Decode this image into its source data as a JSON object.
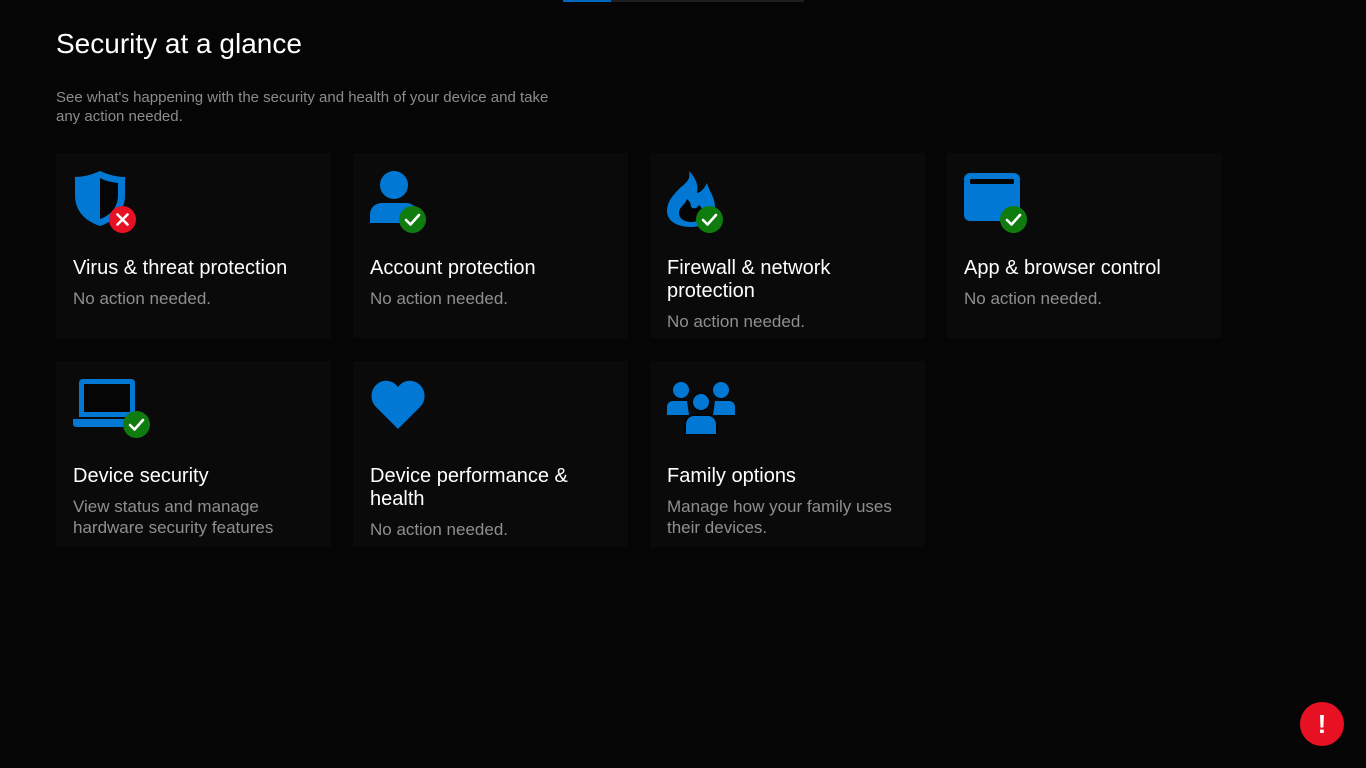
{
  "page": {
    "title": "Security at a glance",
    "subtitle": "See what's happening with the security and health of your device and take any action needed."
  },
  "colors": {
    "background": "#050505",
    "tile_background": "#0a0a0a",
    "accent_blue": "#0078d4",
    "status_ok": "#107c10",
    "status_error": "#e81123",
    "secondary_text": "#8f8f8f"
  },
  "tiles": [
    {
      "icon": "shield-icon",
      "badge": "error-x-icon",
      "title": "Virus & threat protection",
      "status": "No action needed."
    },
    {
      "icon": "person-icon",
      "badge": "checkmark-icon",
      "title": "Account protection",
      "status": "No action needed."
    },
    {
      "icon": "flame-icon",
      "badge": "checkmark-icon",
      "title": "Firewall & network protection",
      "status": "No action needed."
    },
    {
      "icon": "browser-window-icon",
      "badge": "checkmark-icon",
      "title": "App & browser control",
      "status": "No action needed."
    },
    {
      "icon": "laptop-icon",
      "badge": "checkmark-icon",
      "title": "Device security",
      "status": "View status and manage hardware security features"
    },
    {
      "icon": "heart-icon",
      "badge": "",
      "title": "Device performance & health",
      "status": "No action needed."
    },
    {
      "icon": "family-icon",
      "badge": "",
      "title": "Family options",
      "status": "Manage how your family uses their devices."
    }
  ],
  "alert_button": {
    "label": "!",
    "icon": "exclamation-icon"
  }
}
